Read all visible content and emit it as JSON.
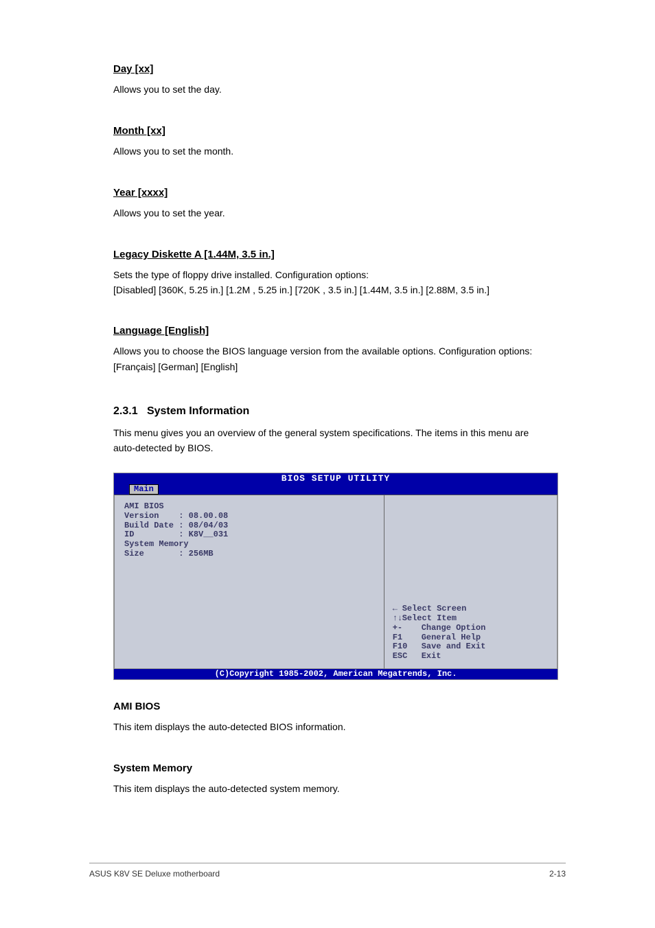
{
  "fields": [
    {
      "label": "Day [xx]",
      "desc": "Allows you to set the day."
    },
    {
      "label": "Month [xx]",
      "desc": "Allows you to set the month."
    },
    {
      "label": "Year [xxxx]",
      "desc": "Allows you to set the year."
    }
  ],
  "legacy": {
    "label": "Legacy Diskette A [1.44M, 3.5 in.]",
    "desc1": "Sets the type of floppy drive installed. Configuration options:",
    "desc2": "[Disabled] [360K, 5.25 in.] [1.2M , 5.25 in.] [720K , 3.5 in.] [1.44M, 3.5 in.] [2.88M, 3.5 in.]"
  },
  "lang": {
    "label": "Language [English]",
    "desc": "Allows you to choose the BIOS language version from the available options. Configuration options: [Français] [German] [English]"
  },
  "section": {
    "num": "2.3.1",
    "title": "System Information",
    "desc": "This menu gives you an overview of the general system specifications. The items in this menu are auto-detected by BIOS."
  },
  "bios": {
    "title": "BIOS SETUP UTILITY",
    "tab": "Main",
    "left_lines": [
      "AMI BIOS",
      "Version    : 08.00.08",
      "Build Date : 08/04/03",
      "ID         : K8V__031",
      "",
      "System Memory",
      "Size       : 256MB"
    ],
    "help": [
      {
        "key": "←",
        "label": "Select Screen"
      },
      {
        "key": "↑↓",
        "label": "Select Item"
      },
      {
        "key": "+-",
        "label": "Change Option"
      },
      {
        "key": "F1",
        "label": "General Help"
      },
      {
        "key": "F10",
        "label": "Save and Exit"
      },
      {
        "key": "ESC",
        "label": "Exit"
      }
    ],
    "copyright": "(C)Copyright 1985-2002, American Megatrends, Inc."
  },
  "below": {
    "ami": {
      "label": "AMI BIOS",
      "desc": "This item displays the auto-detected BIOS information."
    },
    "mem": {
      "label": "System Memory",
      "desc": "This item displays the auto-detected system memory."
    }
  },
  "footer": {
    "left": "ASUS K8V SE Deluxe motherboard",
    "right": "2-13"
  }
}
